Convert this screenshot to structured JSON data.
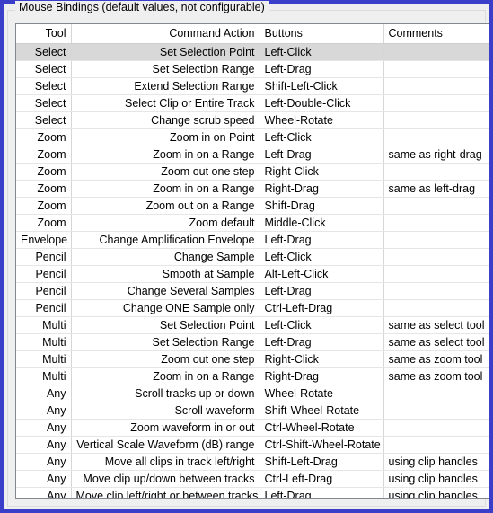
{
  "window": {
    "border_color": "#3a3ec8",
    "background_color": "#efefef"
  },
  "groupbox": {
    "title": "Mouse Bindings (default values, not configurable)"
  },
  "table": {
    "selected_row_index": 0,
    "selected_row_color": "#d8d8d8",
    "columns": [
      {
        "key": "tool",
        "label": "Tool",
        "align": "right"
      },
      {
        "key": "action",
        "label": "Command Action",
        "align": "right"
      },
      {
        "key": "buttons",
        "label": "Buttons",
        "align": "left"
      },
      {
        "key": "comments",
        "label": "Comments",
        "align": "left"
      }
    ],
    "rows": [
      {
        "tool": "Select",
        "action": "Set Selection Point",
        "buttons": "Left-Click",
        "comments": ""
      },
      {
        "tool": "Select",
        "action": "Set Selection Range",
        "buttons": "Left-Drag",
        "comments": ""
      },
      {
        "tool": "Select",
        "action": "Extend Selection Range",
        "buttons": "Shift-Left-Click",
        "comments": ""
      },
      {
        "tool": "Select",
        "action": "Select Clip or Entire Track",
        "buttons": "Left-Double-Click",
        "comments": ""
      },
      {
        "tool": "Select",
        "action": "Change scrub speed",
        "buttons": "Wheel-Rotate",
        "comments": ""
      },
      {
        "tool": "Zoom",
        "action": "Zoom in on Point",
        "buttons": "Left-Click",
        "comments": ""
      },
      {
        "tool": "Zoom",
        "action": "Zoom in on a Range",
        "buttons": "Left-Drag",
        "comments": "same as right-drag"
      },
      {
        "tool": "Zoom",
        "action": "Zoom out one step",
        "buttons": "Right-Click",
        "comments": ""
      },
      {
        "tool": "Zoom",
        "action": "Zoom in on a Range",
        "buttons": "Right-Drag",
        "comments": "same as left-drag"
      },
      {
        "tool": "Zoom",
        "action": "Zoom out on a Range",
        "buttons": "Shift-Drag",
        "comments": ""
      },
      {
        "tool": "Zoom",
        "action": "Zoom default",
        "buttons": "Middle-Click",
        "comments": ""
      },
      {
        "tool": "Envelope",
        "action": "Change Amplification Envelope",
        "buttons": "Left-Drag",
        "comments": ""
      },
      {
        "tool": "Pencil",
        "action": "Change Sample",
        "buttons": "Left-Click",
        "comments": ""
      },
      {
        "tool": "Pencil",
        "action": "Smooth at Sample",
        "buttons": "Alt-Left-Click",
        "comments": ""
      },
      {
        "tool": "Pencil",
        "action": "Change Several Samples",
        "buttons": "Left-Drag",
        "comments": ""
      },
      {
        "tool": "Pencil",
        "action": "Change ONE Sample only",
        "buttons": "Ctrl-Left-Drag",
        "comments": ""
      },
      {
        "tool": "Multi",
        "action": "Set Selection Point",
        "buttons": "Left-Click",
        "comments": "same as select tool"
      },
      {
        "tool": "Multi",
        "action": "Set Selection Range",
        "buttons": "Left-Drag",
        "comments": "same as select tool"
      },
      {
        "tool": "Multi",
        "action": "Zoom out one step",
        "buttons": "Right-Click",
        "comments": "same as zoom tool"
      },
      {
        "tool": "Multi",
        "action": "Zoom in on a Range",
        "buttons": "Right-Drag",
        "comments": "same as zoom tool"
      },
      {
        "tool": "Any",
        "action": "Scroll tracks up or down",
        "buttons": "Wheel-Rotate",
        "comments": ""
      },
      {
        "tool": "Any",
        "action": "Scroll waveform",
        "buttons": "Shift-Wheel-Rotate",
        "comments": ""
      },
      {
        "tool": "Any",
        "action": "Zoom waveform in or out",
        "buttons": "Ctrl-Wheel-Rotate",
        "comments": ""
      },
      {
        "tool": "Any",
        "action": "Vertical Scale Waveform (dB) range",
        "buttons": "Ctrl-Shift-Wheel-Rotate",
        "comments": ""
      },
      {
        "tool": "Any",
        "action": "Move all clips in track left/right",
        "buttons": "Shift-Left-Drag",
        "comments": "using clip handles"
      },
      {
        "tool": "Any",
        "action": "Move clip up/down between tracks",
        "buttons": "Ctrl-Left-Drag",
        "comments": "using clip handles"
      },
      {
        "tool": "Any",
        "action": "Move clip left/right or between tracks",
        "buttons": "Left-Drag",
        "comments": "using clip handles"
      }
    ]
  }
}
